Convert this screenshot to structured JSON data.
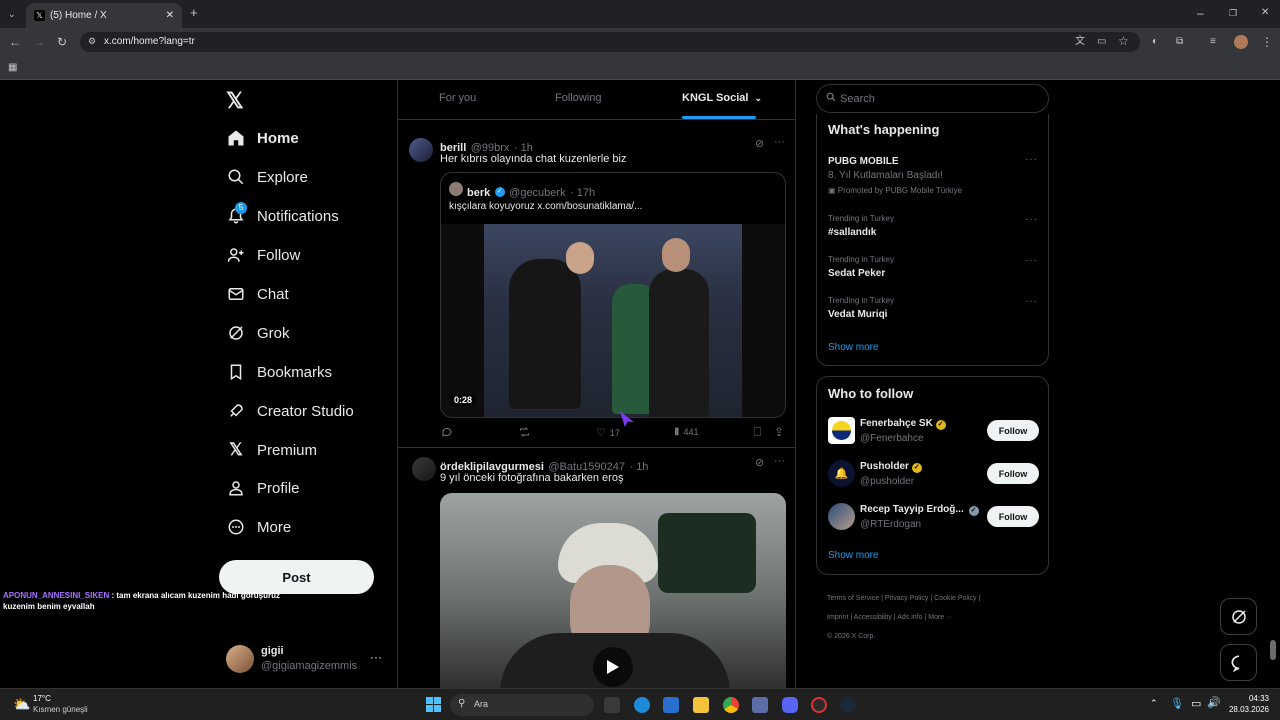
{
  "browser": {
    "tab_title": "(5) Home / X",
    "url": "x.com/home?lang=tr"
  },
  "sidebar": {
    "items": [
      {
        "label": "Home",
        "icon": "home-icon"
      },
      {
        "label": "Explore",
        "icon": "search-icon"
      },
      {
        "label": "Notifications",
        "icon": "bell-icon",
        "badge": "5"
      },
      {
        "label": "Follow",
        "icon": "add-user-icon"
      },
      {
        "label": "Chat",
        "icon": "mail-icon"
      },
      {
        "label": "Grok",
        "icon": "grok-icon"
      },
      {
        "label": "Bookmarks",
        "icon": "bookmark-icon"
      },
      {
        "label": "Creator Studio",
        "icon": "rocket-icon"
      },
      {
        "label": "Premium",
        "icon": "x-logo-icon"
      },
      {
        "label": "Profile",
        "icon": "person-icon"
      },
      {
        "label": "More",
        "icon": "more-circle-icon"
      }
    ],
    "post_label": "Post",
    "account": {
      "name": "gigii",
      "handle": "@gigiamagizemmis"
    }
  },
  "overlay_chat": {
    "user": "APONUN_ANNESINI_SIKEN",
    "message": ": tam ekrana alıcam kuzenim hadi görüşürüz kuzenim benim eyvallah"
  },
  "feed": {
    "tabs": [
      "For you",
      "Following",
      "KNGL Social"
    ],
    "tweet1": {
      "name": "berill",
      "handle": "@99brx",
      "time": "· 1h",
      "text": "Her kıbrıs olayında chat kuzenlerle biz",
      "quote": {
        "name": "berk",
        "handle": "@gecuberk",
        "time": "· 17h",
        "text": "kışçılara koyuyoruz  x.com/bosunatiklama/..."
      },
      "video_time": "0:28",
      "likes": "17",
      "views": "441"
    },
    "tweet2": {
      "name": "ördeklipilavgurmesi",
      "handle": "@Batu1590247",
      "time": "· 1h",
      "text": "9 yıl önceki fotoğrafına bakarken eroş"
    }
  },
  "right": {
    "search_placeholder": "Search",
    "happening": {
      "title": "What's happening",
      "promo": {
        "name": "PUBG MOBILE",
        "desc": "8. Yıl Kutlamaları Başladı!",
        "promoted": "Promoted by PUBG Mobile Türkiye"
      },
      "trends": [
        {
          "meta": "Trending in Turkey",
          "name": "#sallandık"
        },
        {
          "meta": "Trending in Turkey",
          "name": "Sedat Peker"
        },
        {
          "meta": "Trending in Turkey",
          "name": "Vedat Muriqi"
        }
      ],
      "show_more": "Show more"
    },
    "who_to_follow": {
      "title": "Who to follow",
      "accounts": [
        {
          "name": "Fenerbahçe SK",
          "handle": "@Fenerbahce",
          "button": "Follow"
        },
        {
          "name": "Pusholder",
          "handle": "@pusholder",
          "button": "Follow"
        },
        {
          "name": "Recep Tayyip Erdoğ...",
          "handle": "@RTErdogan",
          "button": "Follow"
        }
      ],
      "show_more": "Show more"
    },
    "footer": {
      "links": [
        "Terms of Service",
        "Privacy Policy",
        "Cookie Policy",
        "Imprint",
        "Accessibility",
        "Ads info",
        "More ···"
      ],
      "copyright": "© 2026 X Corp."
    }
  },
  "taskbar": {
    "weather_temp": "17°C",
    "weather_desc": "Kısmen güneşli",
    "search_placeholder": "Ara",
    "time": "04:33",
    "date": "28.03.2026"
  },
  "colors": {
    "accent": "#1d9bf0",
    "background": "#000000",
    "border": "#2f3336",
    "muted_text": "#71767b"
  }
}
